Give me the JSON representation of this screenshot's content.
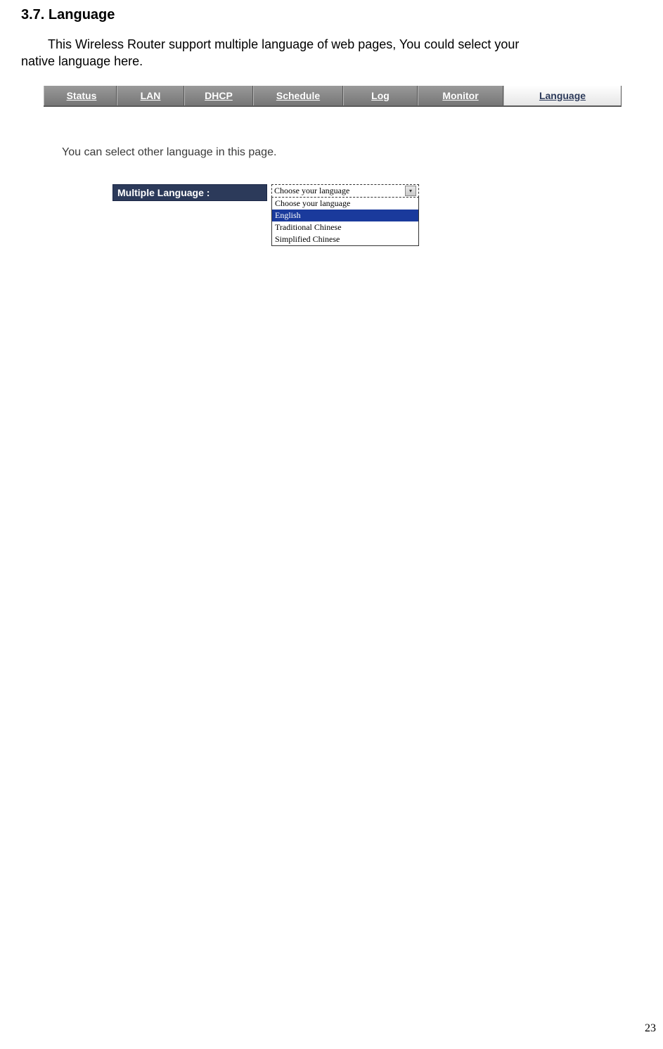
{
  "heading": "3.7. Language",
  "intro_line1": "This Wireless Router support multiple language of web pages, You could select your",
  "intro_line2": "native language here.",
  "tabs": {
    "status": "Status",
    "lan": "LAN",
    "dhcp": "DHCP",
    "schedule": "Schedule",
    "log": "Log",
    "monitor": "Monitor",
    "language": "Language"
  },
  "description": "You can select other language in this page.",
  "form": {
    "label": "Multiple Language :",
    "selected_display": "Choose your language",
    "options": {
      "opt0": "Choose your language",
      "opt1": "English",
      "opt2": "Traditional Chinese",
      "opt3": "Simplified Chinese"
    }
  },
  "page_number": "23"
}
